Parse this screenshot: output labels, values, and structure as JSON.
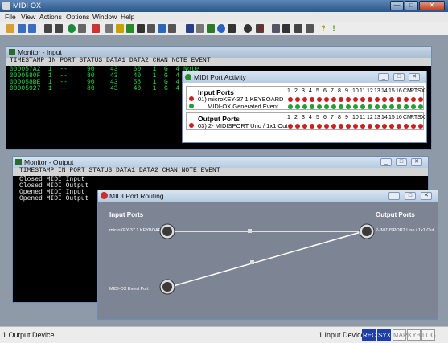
{
  "app": {
    "title": "MIDI-OX",
    "title_buttons": [
      "—",
      "□",
      "✕"
    ]
  },
  "menu": [
    "File",
    "View",
    "Actions",
    "Options",
    "Window",
    "Help"
  ],
  "toolbar_icons": [
    "open-icon",
    "save-icon",
    "save-all-icon",
    "record-icon",
    "stop-icon",
    "play-icon",
    "grid-icon",
    "keyboard-icon",
    "status-icon",
    "pencil-icon",
    "sysex-icon",
    "monitor-icon",
    "port-icon",
    "routing-icon",
    "mapper-icon",
    "piano-icon",
    "filter-icon",
    "music-note-icon",
    "loop-icon",
    "globe-icon",
    "clock-icon",
    "pause-icon",
    "note-icon",
    "delete-icon",
    "window-icon",
    "clipboard-icon",
    "print-icon",
    "wrench-icon",
    "help-icon",
    "exclamation-icon"
  ],
  "monitor_input": {
    "title": "Monitor - Input",
    "header": "TIMESTAMP IN PORT STATUS DATA1 DATA2 CHAN NOTE EVENT",
    "rows": [
      "000057A2  1  --     90    43    60   1  G  4 Note",
      "0000580F  1  --     80    43    40   1  G  4 Note",
      "000058BE  1  --     90    43    58   1  G  4 Note",
      "00005927  1  --     80    43    40   1  G  4 Note"
    ]
  },
  "monitor_output": {
    "title": "Monitor - Output",
    "header": "TIMESTAMP IN PORT STATUS DATA1 DATA2 CHAN NOTE EVENT",
    "rows": [
      "Closed MIDI Input",
      "Closed MIDI Output",
      "Opened MIDI Input",
      "Opened MIDI Output"
    ]
  },
  "port_activity": {
    "title": "MIDI Port Activity",
    "input_heading": "Input Ports",
    "input_port": "01) microKEY-37 1 KEYBOARD",
    "input_event": "MIDI-OX Generated Event",
    "output_heading": "Output Ports",
    "output_port": "03) 2- MIDISPORT Uno / 1x1 Out",
    "channels": [
      "1",
      "2",
      "3",
      "4",
      "5",
      "6",
      "7",
      "8",
      "9",
      "10",
      "11",
      "12",
      "13",
      "14",
      "15",
      "16",
      "CM",
      "RT",
      "SX"
    ]
  },
  "port_routing": {
    "title": "MIDI Port Routing",
    "input_heading": "Input Ports",
    "output_heading": "Output Ports",
    "input1": "microKEY-37 1 KEYBOARD",
    "input2": "MIDI-OX Event Port",
    "output1": "2- MIDISPORT Uno / 1x1 Out"
  },
  "status": {
    "left": "1 Output Device",
    "right": "1 Input Device",
    "indicators": [
      {
        "label": "REC",
        "active": true
      },
      {
        "label": "SYX",
        "active": true
      },
      {
        "label": "MAP",
        "active": false
      },
      {
        "label": "KYB",
        "active": false
      },
      {
        "label": "LOG",
        "active": false
      }
    ]
  },
  "colors": {
    "monitor_text_green": "#22dd44",
    "monitor_header_bg": "#d4d4d4",
    "indicator_active": "#1e3ea8",
    "routing_bg": "#7d8594",
    "led_red": "#cc2020",
    "led_green": "#20a030"
  }
}
